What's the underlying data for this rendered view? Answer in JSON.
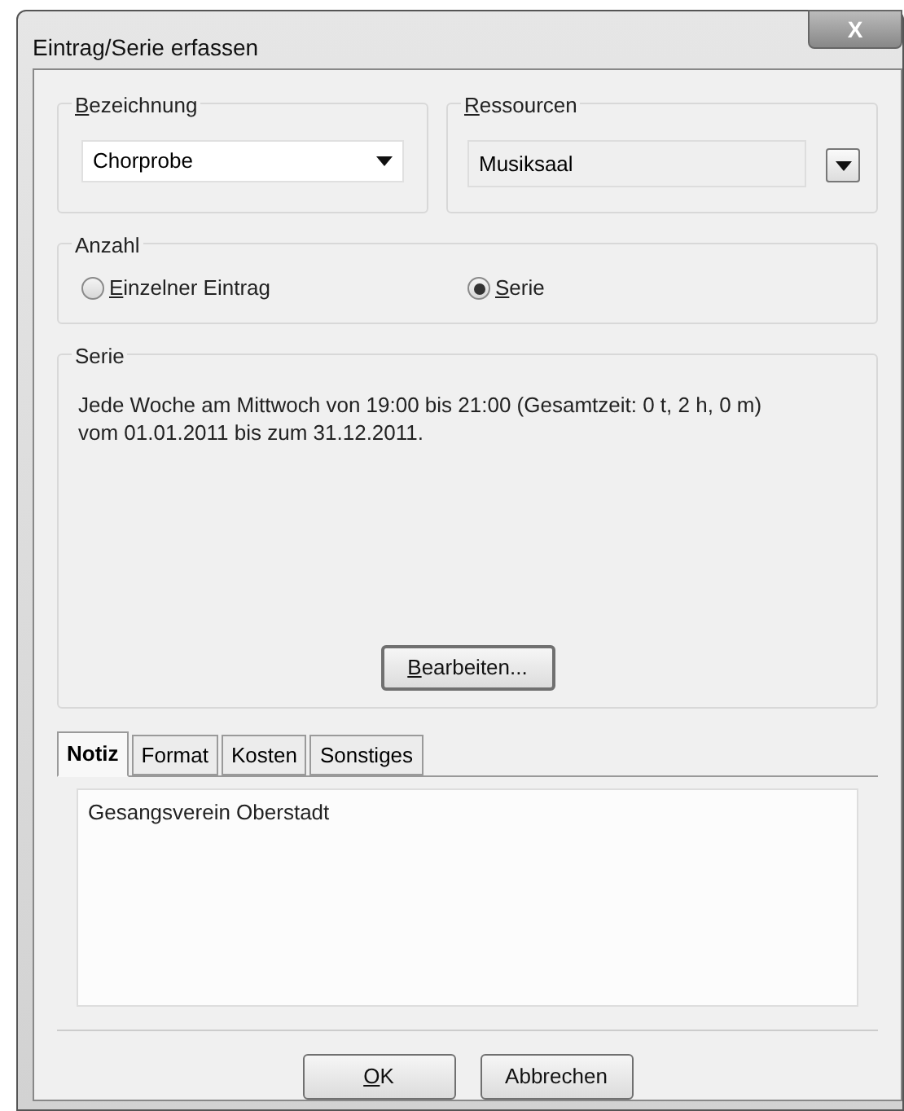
{
  "window": {
    "title": "Eintrag/Serie erfassen",
    "close": "X"
  },
  "bezeichnung": {
    "label": "Bezeichnung",
    "mnemonic": true,
    "value": "Chorprobe"
  },
  "ressourcen": {
    "label": "Ressourcen",
    "mnemonic": true,
    "value": "Musiksaal"
  },
  "anzahl": {
    "label": "Anzahl",
    "options": [
      {
        "label": "Einzelner Eintrag",
        "mnemonic": true,
        "selected": false
      },
      {
        "label": "Serie",
        "mnemonic": true,
        "selected": true
      }
    ]
  },
  "serie": {
    "label": "Serie",
    "description": "Jede Woche am Mittwoch von 19:00 bis 21:00 (Gesamtzeit: 0 t, 2 h, 0 m) vom 01.01.2011 bis zum 31.12.2011.",
    "edit_button": {
      "label": "Bearbeiten...",
      "mnemonic": true
    }
  },
  "tabs": [
    {
      "label": "Notiz",
      "selected": true
    },
    {
      "label": "Format",
      "selected": false
    },
    {
      "label": "Kosten",
      "selected": false
    },
    {
      "label": "Sonstiges",
      "selected": false
    }
  ],
  "note": {
    "value": "Gesangsverein Oberstadt"
  },
  "buttons": [
    {
      "label": "OK",
      "mnemonic": true
    },
    {
      "label": "Abbrechen",
      "mnemonic": false
    }
  ]
}
